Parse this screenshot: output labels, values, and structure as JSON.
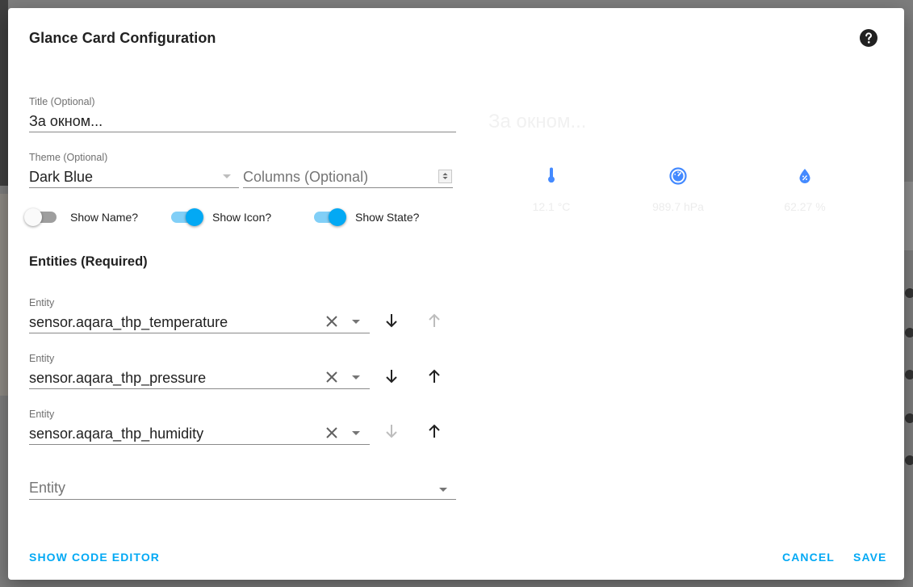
{
  "dialog": {
    "title": "Glance Card Configuration",
    "help_icon": "help-circle-icon"
  },
  "form": {
    "title_field": {
      "label": "Title (Optional)",
      "value": "За окном..."
    },
    "theme_field": {
      "label": "Theme (Optional)",
      "value": "Dark Blue"
    },
    "columns_field": {
      "placeholder": "Columns (Optional)"
    },
    "toggles": [
      {
        "label": "Show Name?",
        "on": false
      },
      {
        "label": "Show Icon?",
        "on": true
      },
      {
        "label": "Show State?",
        "on": true
      }
    ],
    "entities_title": "Entities (Required)",
    "entity_label": "Entity",
    "entities": [
      {
        "label": "Entity",
        "value": "sensor.aqara_thp_temperature",
        "down_enabled": true,
        "up_enabled": false
      },
      {
        "label": "Entity",
        "value": "sensor.aqara_thp_pressure",
        "down_enabled": true,
        "up_enabled": true
      },
      {
        "label": "Entity",
        "value": "sensor.aqara_thp_humidity",
        "down_enabled": false,
        "up_enabled": true
      }
    ],
    "new_entity_placeholder": "Entity"
  },
  "preview": {
    "title": "За окном...",
    "items": [
      {
        "icon": "thermometer-icon",
        "value": "12.1 °C"
      },
      {
        "icon": "gauge-icon",
        "value": "989.7 hPa"
      },
      {
        "icon": "water-percent-icon",
        "value": "62.27 %"
      }
    ],
    "icon_color": "#448aff"
  },
  "actions": {
    "show_code_editor": "SHOW CODE EDITOR",
    "cancel": "CANCEL",
    "save": "SAVE"
  },
  "colors": {
    "accent": "#03a9f4"
  }
}
